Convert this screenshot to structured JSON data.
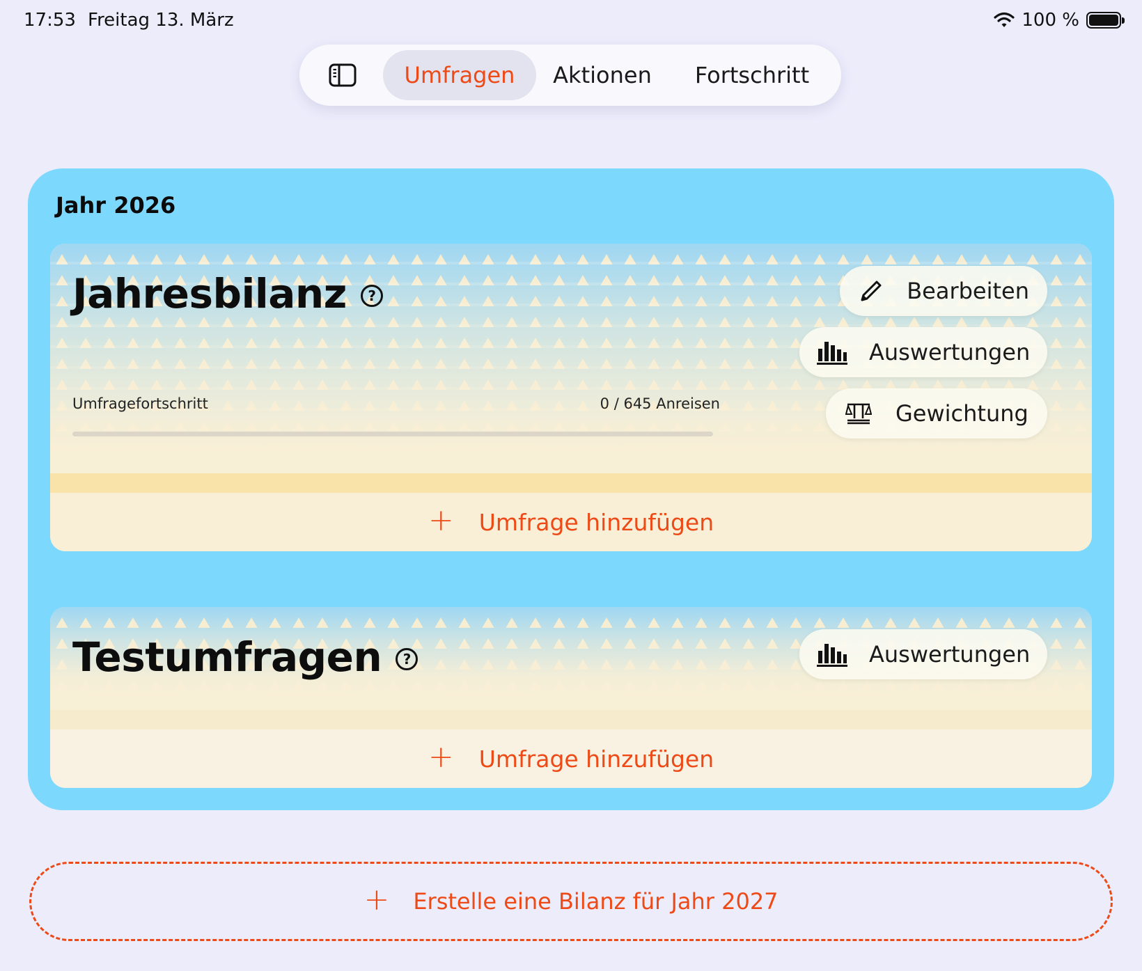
{
  "status_bar": {
    "time": "17:53",
    "date": "Freitag 13. März",
    "battery": "100 %",
    "icons": [
      "wifi-icon",
      "battery-icon"
    ]
  },
  "nav": {
    "sidebar_icon": "sidebar-toggle-icon",
    "tabs": [
      {
        "label": "Umfragen",
        "active": true
      },
      {
        "label": "Aktionen",
        "active": false
      },
      {
        "label": "Fortschritt",
        "active": false
      }
    ]
  },
  "year_section": {
    "title": "Jahr 2026",
    "cards": [
      {
        "title": "Jahresbilanz",
        "help_icon": "question-circle-icon",
        "actions": [
          {
            "label": "Bearbeiten",
            "icon": "pencil-icon"
          },
          {
            "label": "Auswertungen",
            "icon": "bar-chart-icon"
          },
          {
            "label": "Gewichtung",
            "icon": "scales-icon"
          }
        ],
        "progress": {
          "label": "Umfragefortschritt",
          "count": "0 / 645 Anreisen",
          "value": 0,
          "max": 645
        },
        "add_label": "Umfrage hinzufügen"
      },
      {
        "title": "Testumfragen",
        "help_icon": "question-circle-icon",
        "actions": [
          {
            "label": "Auswertungen",
            "icon": "bar-chart-icon"
          }
        ],
        "add_label": "Umfrage hinzufügen"
      }
    ]
  },
  "create_button": {
    "label": "Erstelle eine Bilanz für Jahr 2027",
    "icon": "plus-icon"
  },
  "colors": {
    "accent": "#ee4a17",
    "year_bg": "#7dd8fd",
    "page_bg": "#ececfb",
    "card_bg": "#f8efd7"
  }
}
